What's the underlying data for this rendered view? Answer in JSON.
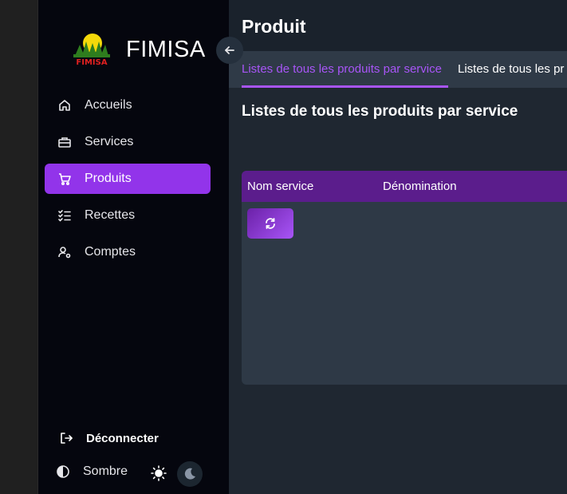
{
  "brand": {
    "name": "FIMISA",
    "logo_text": "FIMISA"
  },
  "sidebar": {
    "items": [
      {
        "label": "Accueils",
        "icon": "home-icon",
        "active": false
      },
      {
        "label": "Services",
        "icon": "briefcase-icon",
        "active": false
      },
      {
        "label": "Produits",
        "icon": "cart-icon",
        "active": true
      },
      {
        "label": "Recettes",
        "icon": "checklist-icon",
        "active": false
      },
      {
        "label": "Comptes",
        "icon": "user-settings-icon",
        "active": false
      }
    ],
    "logout_label": "Déconnecter",
    "theme_label": "Sombre"
  },
  "header": {
    "title": "Produit"
  },
  "tabs": [
    {
      "label": "Listes de tous les produits par service",
      "active": true
    },
    {
      "label": "Listes de tous les pr",
      "active": false
    }
  ],
  "main": {
    "section_title": "Listes de tous les produits par service",
    "table": {
      "columns": [
        "Nom service",
        "Dénomination"
      ]
    }
  },
  "colors": {
    "accent": "#9234ea",
    "accent_text": "#a855f7",
    "sidebar_bg": "#05060e",
    "main_bg": "#1f2731",
    "table_header": "#5b1d8c"
  }
}
